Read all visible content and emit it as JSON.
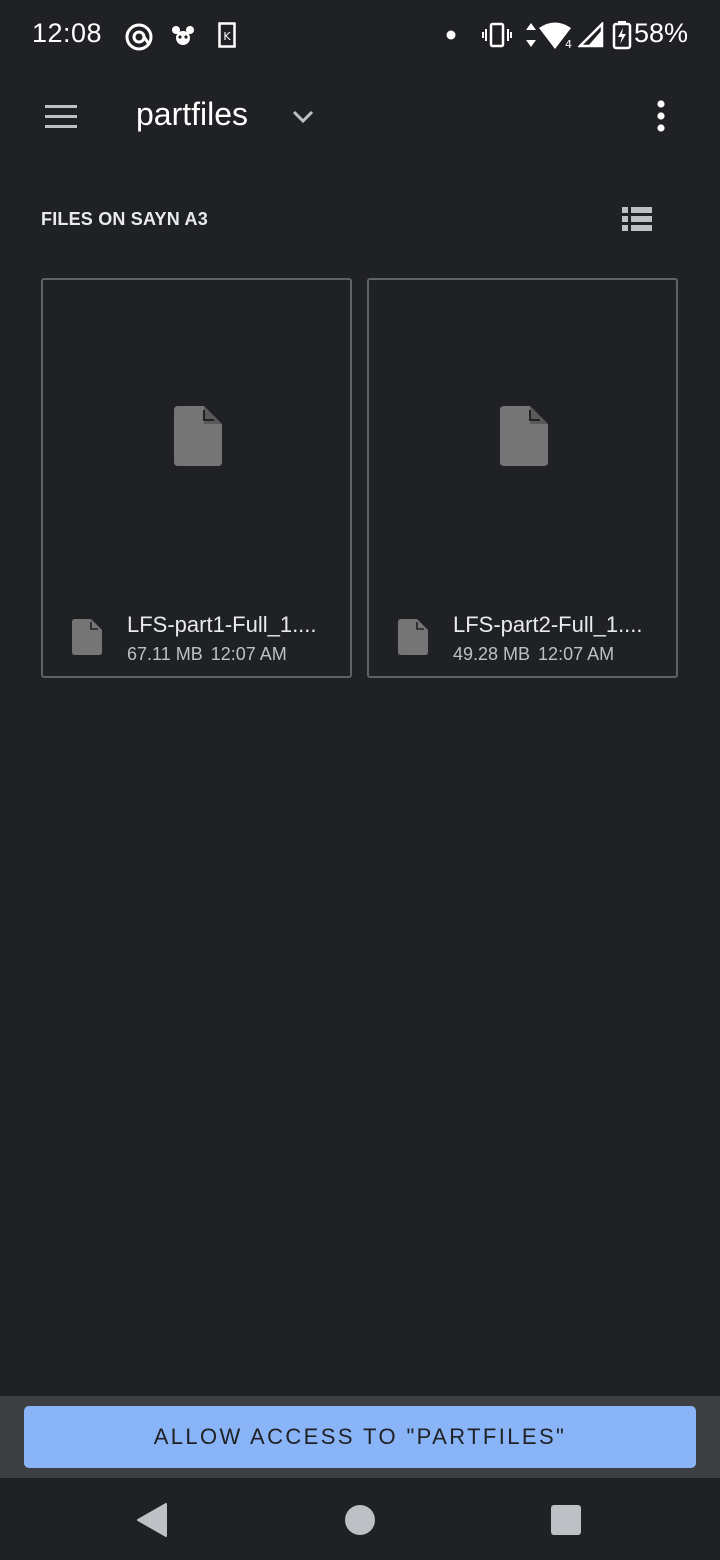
{
  "status_bar": {
    "time": "12:08",
    "battery_percent": "58%",
    "icons": [
      "at-sign-icon",
      "bug-icon",
      "k-card-icon",
      "dot-icon",
      "vibrate-icon",
      "data-arrows-icon",
      "wifi-icon",
      "cell-signal-icon",
      "battery-charging-icon"
    ]
  },
  "app_bar": {
    "title": "partfiles",
    "icons": [
      "menu-icon",
      "chevron-down-icon",
      "more-vert-icon"
    ]
  },
  "section": {
    "title": "FILES ON SAYN A3",
    "view_toggle_icon": "list-view-icon"
  },
  "files": [
    {
      "name": "LFS-part1-Full_1....",
      "size": "67.11 MB",
      "time": "12:07 AM",
      "icon": "file-icon"
    },
    {
      "name": "LFS-part2-Full_1....",
      "size": "49.28 MB",
      "time": "12:07 AM",
      "icon": "file-icon"
    }
  ],
  "action": {
    "allow_label": "ALLOW ACCESS TO \"PARTFILES\""
  },
  "nav": {
    "icons": [
      "back-icon",
      "home-icon",
      "recents-icon"
    ]
  },
  "colors": {
    "background": "#202124",
    "accent": "#8ab4f8",
    "panel": "#3c4043",
    "border": "#5f6368"
  }
}
